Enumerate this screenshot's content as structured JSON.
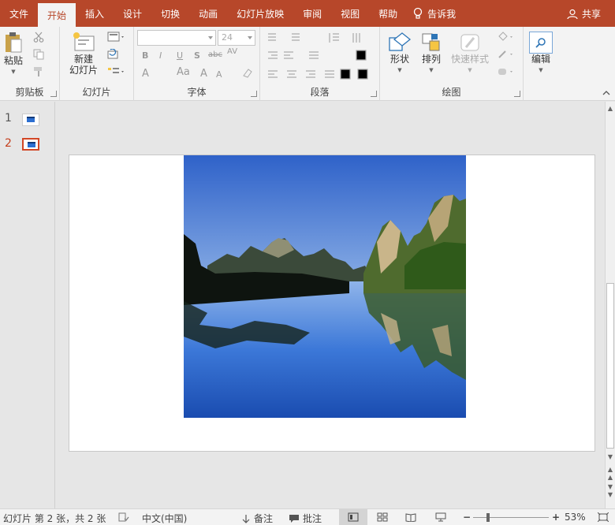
{
  "tabs": [
    {
      "label": "文件"
    },
    {
      "label": "开始"
    },
    {
      "label": "插入"
    },
    {
      "label": "设计"
    },
    {
      "label": "切换"
    },
    {
      "label": "动画"
    },
    {
      "label": "幻灯片放映"
    },
    {
      "label": "审阅"
    },
    {
      "label": "视图"
    },
    {
      "label": "帮助"
    }
  ],
  "tell_me": "告诉我",
  "share": "共享",
  "ribbon": {
    "clipboard": {
      "label": "剪贴板",
      "paste": "粘贴"
    },
    "slides": {
      "label": "幻灯片",
      "new_slide_line1": "新建",
      "new_slide_line2": "幻灯片"
    },
    "font": {
      "label": "字体",
      "font_name": "",
      "font_size": "24"
    },
    "paragraph": {
      "label": "段落"
    },
    "drawing": {
      "label": "绘图",
      "shapes": "形状",
      "arrange": "排列",
      "quick_styles": "快速样式"
    },
    "editing": {
      "label": "编辑"
    }
  },
  "thumbnails": [
    {
      "number": "1"
    },
    {
      "number": "2"
    }
  ],
  "status": {
    "slide_info": "幻灯片 第 2 张，共 2 张",
    "language": "中文(中国)",
    "notes": "备注",
    "comments": "批注",
    "zoom": "53%"
  },
  "colors": {
    "accent": "#b7472a",
    "selected_thumb": "#d24726"
  }
}
